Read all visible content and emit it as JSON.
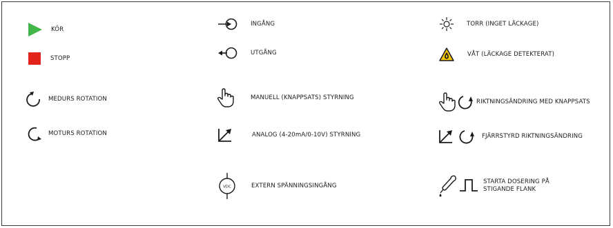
{
  "colors": {
    "run": "#43b649",
    "stop": "#e2231a",
    "warning": "#f5c400",
    "ink": "#1a1a1a"
  },
  "legend": {
    "run": {
      "label": "KÖR",
      "icon": "play-triangle-icon"
    },
    "stop": {
      "label": "STOPP",
      "icon": "stop-square-icon"
    },
    "cw": {
      "label": "MEDURS ROTATION",
      "icon": "clockwise-arrow-icon"
    },
    "ccw": {
      "label": "MOTURS ROTATION",
      "icon": "counterclockwise-arrow-icon"
    },
    "input": {
      "label": "INGÅNG",
      "icon": "input-arrow-icon"
    },
    "output": {
      "label": "UTGÅNG",
      "icon": "output-arrow-icon"
    },
    "manual": {
      "label": "MANUELL (KNAPPSATS) STYRNING",
      "icon": "pointing-hand-icon"
    },
    "analog": {
      "label": "ANALOG (4-20mA/0-10V) STYRNING",
      "icon": "analog-ramp-icon"
    },
    "ext_voltage": {
      "label": "EXTERN SPÄNNINGSINGÅNG",
      "icon": "vdc-input-icon",
      "icon_text": "VDC"
    },
    "dry": {
      "label": "TORR (INGET LÄCKAGE)",
      "icon": "sun-icon"
    },
    "wet": {
      "label": "VÅT (LÄCKAGE DETEKTERAT)",
      "icon": "leak-warning-icon"
    },
    "keypad_dir": {
      "label": "RIKTNINGSÄNDRING MED KNAPPSATS",
      "icon": "hand-and-rotation-icon"
    },
    "remote_dir": {
      "label": "FJÄRRSTYRD RIKTNINGSÄNDRING",
      "icon": "ramp-and-rotation-icon"
    },
    "dose_edge": {
      "label": "STARTA DOSERING PÅ STIGANDE FLANK",
      "icon": "pipette-rising-edge-icon"
    }
  }
}
